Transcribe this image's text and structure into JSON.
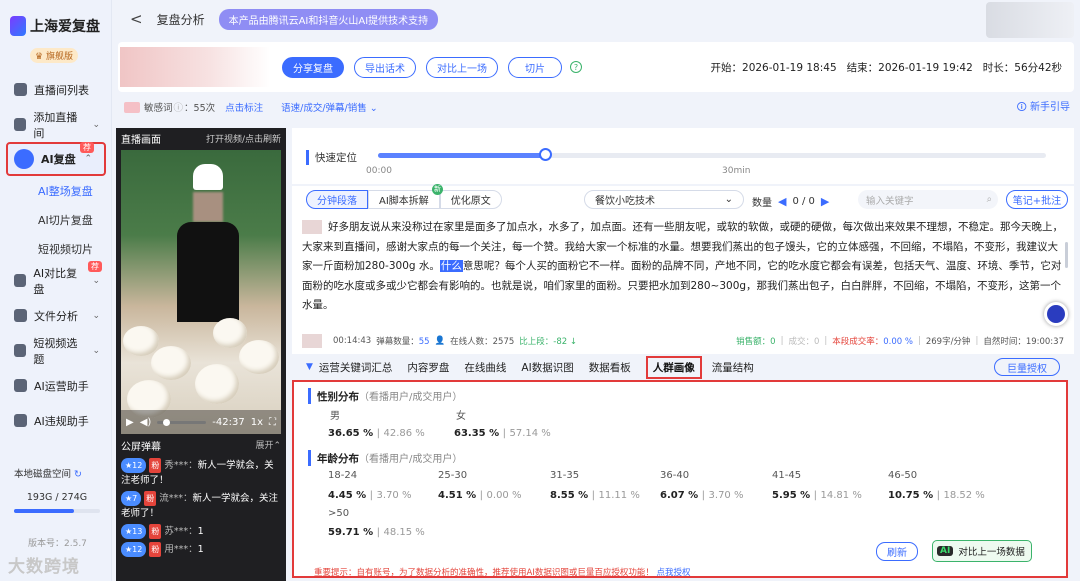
{
  "brand": {
    "name": "上海爱复盘",
    "tier": "旗舰版"
  },
  "sidebar": {
    "items": [
      {
        "label": "直播间列表",
        "icon": "chart-icon"
      },
      {
        "label": "添加直播间",
        "icon": "user-add-icon",
        "chevron": "⌄"
      },
      {
        "label": "AI复盘",
        "icon": "ai-icon",
        "badge": "荐",
        "chevron": "⌃"
      },
      {
        "label": "AI对比复盘",
        "icon": "vs-icon",
        "badge": "荐",
        "chevron": "⌄"
      },
      {
        "label": "文件分析",
        "icon": "file-icon",
        "chevron": "⌄"
      },
      {
        "label": "短视频选题",
        "icon": "video-icon",
        "chevron": "⌄"
      },
      {
        "label": "AI运营助手",
        "icon": "robot-icon"
      },
      {
        "label": "AI违规助手",
        "icon": "shield-icon"
      }
    ],
    "subitems": [
      "AI整场复盘",
      "AI切片复盘",
      "短视频切片"
    ],
    "storage": {
      "label": "本地磁盘空间",
      "value": "193G / 274G",
      "ratio": 0.7
    },
    "version": "版本号：2.5.7",
    "watermark": "大数跨境"
  },
  "header": {
    "back": "<",
    "title": "复盘分析",
    "tech_note": "本产品由腾讯云AI和抖音火山AI提供技术支持"
  },
  "toolbar": {
    "share": "分享复盘",
    "export": "导出话术",
    "compare": "对比上一场",
    "slice": "切片",
    "help": "?",
    "time": "开始：2026-01-19 18:45   结束：2026-01-19 19:42   时长：56分42秒"
  },
  "sensitive": {
    "label": "敏感词",
    "count": "：55次",
    "mark_link": "点击标注",
    "filters": "语速/成交/弹幕/销售",
    "guide": "新手引导"
  },
  "video": {
    "title": "直播画面",
    "open": "打开视频/点击刷新",
    "play": "▶",
    "volume": "◀)",
    "remaining": "-42:37",
    "speed": "1x",
    "fullscreen": "⛶",
    "danmu_title": "公屏弹幕",
    "danmu_toggle": "展开⌃"
  },
  "danmu": [
    {
      "level": "12",
      "user": "秀***：",
      "text": "新人一学就会，关注老师了！"
    },
    {
      "level": "7",
      "user": "流***：",
      "text": "新人一学就会，关注老师了！"
    },
    {
      "level": "13",
      "user": "苏***：",
      "text": "1"
    },
    {
      "level": "12",
      "user": "用***：",
      "text": "1"
    }
  ],
  "danmu_fan_label": "粉",
  "quick_locate": {
    "label": "快速定位",
    "start": "00:00",
    "end": "30min",
    "progress": 0.25
  },
  "transcript": {
    "tabs": [
      "分钟段落",
      "AI脚本拆解",
      "优化原文"
    ],
    "tab_badge": "新",
    "category": "餐饮小吃技术",
    "count_label": "数量",
    "count_value": "0 / 0",
    "prev": "◀",
    "next": "▶",
    "search_placeholder": "输入关键字",
    "note_btn": "笔记+批注",
    "text_before": "好多朋友说从来没称过在家里是面多了加点水，水多了，加点面。还有一些朋友呢，或软的软做，或硬的硬做，每次做出来效果不理想，不稳定。那今天晚上，大家来到直播间，感谢大家点的每一个关注，每一个赞。我给大家一个标准的水量。想要我们蒸出的包子馒头，它的立体感强，不回缩，不塌陷，不变形，我建议大家一斤面粉加280-300g 水。",
    "highlight": "什么",
    "text_after": "意思呢？每个人买的面粉它不一样。面粉的品牌不同，产地不同，它的吃水度它都会有误差，包括天气、温度、环境、季节，它对面粉的吃水度或多或少它都会有影响的。也就是说，咱们家里的面粉。只要把水加到280~300g，那我们蒸出包子，白白胖胖，不回缩，不塌陷，不变形，这第一个水量。",
    "stats": {
      "time": "00:14:43",
      "danmu": "弹幕数量：",
      "danmu_val": "55",
      "online": "在线人数：2575",
      "compare": "比上段：-82",
      "sales": "销售额：0",
      "deals": "成交：0",
      "conv": "本段成交率：",
      "conv_val": "0.00 %",
      "speed": "269字/分钟",
      "clock": "自然时间：19:00:37"
    }
  },
  "tabs2": [
    "运营关键词汇总",
    "内容罗盘",
    "在线曲线",
    "AI数据识图",
    "数据看板",
    "人群画像",
    "流量结构"
  ],
  "tabs2_active": "人群画像",
  "juliang_btn": "巨量授权",
  "portrait": {
    "gender_title": "性别分布",
    "gender_sub": "（看播用户/成交用户）",
    "gender": [
      {
        "label": "男",
        "watch": "36.65 %",
        "deal": "42.86 %"
      },
      {
        "label": "女",
        "watch": "63.35 %",
        "deal": "57.14 %"
      }
    ],
    "age_title": "年龄分布",
    "age_sub": "（看播用户/成交用户）",
    "age": [
      {
        "label": "18-24",
        "watch": "4.45 %",
        "deal": "3.70 %"
      },
      {
        "label": "25-30",
        "watch": "4.51 %",
        "deal": "0.00 %"
      },
      {
        "label": "31-35",
        "watch": "8.55 %",
        "deal": "11.11 %"
      },
      {
        "label": "36-40",
        "watch": "6.07 %",
        "deal": "3.70 %"
      },
      {
        "label": "41-45",
        "watch": "5.95 %",
        "deal": "14.81 %"
      },
      {
        "label": "46-50",
        "watch": "10.75 %",
        "deal": "18.52 %"
      },
      {
        "label": ">50",
        "watch": "59.71 %",
        "deal": "48.15 %"
      }
    ],
    "separator": "|",
    "refresh": "刷新",
    "compare_chip": "AI",
    "compare_btn": "对比上一场数据",
    "tip": "重要提示：自有账号，为了数据分析的准确性，推荐使用AI数据识图或巨量百应授权功能！",
    "tip_link": "点我授权"
  },
  "colors": {
    "accent": "#3b6cff",
    "highlight_border": "#e23a3a",
    "success": "#3bb36b"
  }
}
